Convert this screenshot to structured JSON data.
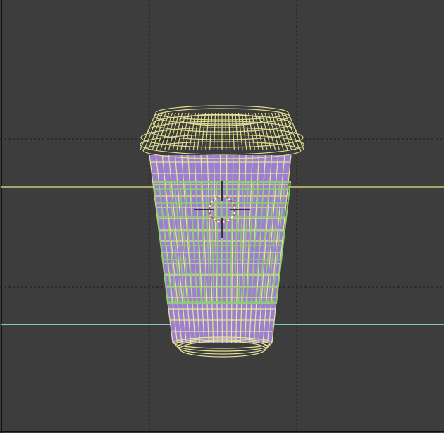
{
  "viewport": {
    "view": "3d-viewport",
    "shading": "wireframe",
    "object": "cup",
    "colors": {
      "background": "#3d3d3d",
      "guide_dashed": "#1c1c1c",
      "edge_line": "#111111",
      "horizon_yellow": "#a7a56b",
      "horizon_cyan": "#7fc7bb",
      "cup_fill": "#9c7fd0",
      "lid_wire": "#dcdc8c",
      "sleeve_wire": "#8fcf6e",
      "cup_wire": "#e6e39a",
      "cursor_red": "#d04040",
      "cursor_dark": "#111111"
    },
    "icons": [
      "3d-cursor-icon"
    ]
  }
}
